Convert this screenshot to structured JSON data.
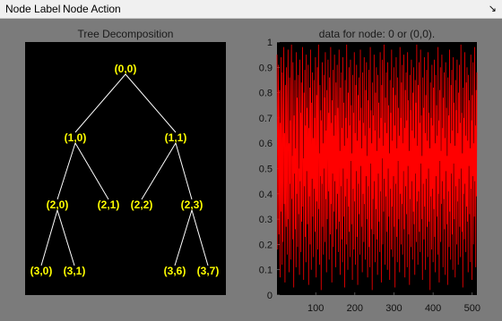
{
  "menubar": {
    "items": [
      "Node Label",
      "Node Action"
    ],
    "dock_icon": "dock-arrow-icon"
  },
  "tree_panel": {
    "title": "Tree Decomposition",
    "background": "#000000",
    "node_color": "#ffff00",
    "edge_color": "#ffffff",
    "nodes": [
      {
        "id": "n00",
        "label": "(0,0)"
      },
      {
        "id": "n10",
        "label": "(1,0)"
      },
      {
        "id": "n11",
        "label": "(1,1)"
      },
      {
        "id": "n20",
        "label": "(2,0)"
      },
      {
        "id": "n21",
        "label": "(2,1)"
      },
      {
        "id": "n22",
        "label": "(2,2)"
      },
      {
        "id": "n23",
        "label": "(2,3)"
      },
      {
        "id": "n30",
        "label": "(3,0)"
      },
      {
        "id": "n31",
        "label": "(3,1)"
      },
      {
        "id": "n36",
        "label": "(3,6)"
      },
      {
        "id": "n37",
        "label": "(3,7)"
      }
    ],
    "edges": [
      [
        "n00",
        "n10"
      ],
      [
        "n00",
        "n11"
      ],
      [
        "n10",
        "n20"
      ],
      [
        "n10",
        "n21"
      ],
      [
        "n11",
        "n22"
      ],
      [
        "n11",
        "n23"
      ],
      [
        "n20",
        "n30"
      ],
      [
        "n20",
        "n31"
      ],
      [
        "n23",
        "n36"
      ],
      [
        "n23",
        "n37"
      ]
    ]
  },
  "chart_data": {
    "type": "line",
    "title": "data for node: 0 or (0,0).",
    "xlim": [
      1,
      512
    ],
    "ylim": [
      0,
      1
    ],
    "x_ticks": [
      100,
      200,
      300,
      400,
      500
    ],
    "y_ticks": [
      0,
      0.1,
      0.2,
      0.3,
      0.4,
      0.5,
      0.6,
      0.7,
      0.8,
      0.9,
      1
    ],
    "background": "#000000",
    "line_color": "#ff0000",
    "series": [
      {
        "values": [
          0.95,
          0.62,
          0.18,
          0.77,
          0.91,
          0.24,
          0.56,
          0.81,
          0.07,
          0.68,
          0.33,
          0.94,
          0.47,
          0.12,
          0.88,
          0.59,
          0.21,
          0.73,
          0.98,
          0.36,
          0.64,
          0.05,
          0.83,
          0.41,
          0.27,
          0.9,
          0.52,
          0.16,
          0.75,
          0.97,
          0.3,
          0.6,
          0.09,
          0.86,
          0.44,
          0.69,
          0.14,
          0.79,
          0.99,
          0.38,
          0.55,
          0.22,
          0.92,
          0.65,
          0.03,
          0.71,
          0.48,
          0.85,
          0.26,
          0.58,
          0.11,
          0.96,
          0.4,
          0.78,
          0.19,
          0.63,
          0.87,
          0.32,
          0.5,
          0.08,
          0.93,
          0.45,
          0.72,
          0.17,
          0.84,
          0.29,
          0.61,
          0.98,
          0.35,
          0.54,
          0.06,
          0.8,
          0.43,
          0.89,
          0.23,
          0.67,
          0.13,
          0.95,
          0.49,
          0.74,
          0.28,
          0.57,
          0.91,
          0.04,
          0.66,
          0.39,
          0.82,
          0.2,
          0.97,
          0.53,
          0.1,
          0.76,
          0.46,
          0.88,
          0.31,
          0.62,
          0.15,
          0.85,
          0.42,
          0.7,
          0.25,
          0.94,
          0.51,
          0.07,
          0.79,
          0.37,
          0.9,
          0.18,
          0.64,
          0.99,
          0.34,
          0.56,
          0.12,
          0.83,
          0.47,
          0.73,
          0.02,
          0.69,
          0.44,
          0.92,
          0.27,
          0.6,
          0.16,
          0.87,
          0.5,
          0.78,
          0.21,
          0.96,
          0.38,
          0.65,
          0.09,
          0.81,
          0.3,
          0.58,
          0.93,
          0.41,
          0.72,
          0.14,
          0.86,
          0.55,
          0.24,
          0.98,
          0.36,
          0.68,
          0.05,
          0.77,
          0.48,
          0.89,
          0.19,
          0.63,
          0.33,
          0.95,
          0.45,
          0.71,
          0.11,
          0.84,
          0.52,
          0.26,
          0.91,
          0.4,
          0.74,
          0.17,
          0.6,
          0.97,
          0.29,
          0.57,
          0.08,
          0.82,
          0.43,
          0.88,
          0.22,
          0.66,
          0.13,
          0.94,
          0.5,
          0.76,
          0.31,
          0.59,
          0.03,
          0.85,
          0.39,
          0.7,
          0.2,
          0.99,
          0.46,
          0.62,
          0.1,
          0.8,
          0.35,
          0.9,
          0.25,
          0.67,
          0.15,
          0.93,
          0.53,
          0.75,
          0.28,
          0.56,
          0.06,
          0.87,
          0.42,
          0.72,
          0.18,
          0.96,
          0.37,
          0.64,
          0.12,
          0.83,
          0.49,
          0.91,
          0.23,
          0.61,
          0.04,
          0.79,
          0.44,
          0.86,
          0.32,
          0.69,
          0.16,
          0.97,
          0.51,
          0.74,
          0.27,
          0.58,
          0.09,
          0.88,
          0.4,
          0.68,
          0.21,
          0.94,
          0.36,
          0.63,
          0.14,
          0.81,
          0.47,
          0.92,
          0.3,
          0.55,
          0.07,
          0.77,
          0.43,
          0.89,
          0.19,
          0.66,
          0.11,
          0.98,
          0.52,
          0.73,
          0.26,
          0.6,
          0.02,
          0.84,
          0.38,
          0.71,
          0.24,
          0.95,
          0.45,
          0.65,
          0.13,
          0.8,
          0.34,
          0.9,
          0.22,
          0.57,
          0.08,
          0.87,
          0.48,
          0.76,
          0.29,
          0.62,
          0.17,
          0.96,
          0.41,
          0.7,
          0.05,
          0.83,
          0.54,
          0.93,
          0.2,
          0.59,
          0.33,
          0.99,
          0.46,
          0.68,
          0.12,
          0.78,
          0.39,
          0.88,
          0.25,
          0.64,
          0.1,
          0.92,
          0.5,
          0.75,
          0.31,
          0.56,
          0.06,
          0.85,
          0.42,
          0.72,
          0.18,
          0.97,
          0.35,
          0.61,
          0.15,
          0.82,
          0.47,
          0.9,
          0.27,
          0.67,
          0.03,
          0.79,
          0.44,
          0.94,
          0.23,
          0.58,
          0.13,
          0.86,
          0.53,
          0.74,
          0.3,
          0.63,
          0.09,
          0.98,
          0.4,
          0.7,
          0.2,
          0.84,
          0.36,
          0.91,
          0.16,
          0.6,
          0.49,
          0.95,
          0.26,
          0.66,
          0.07,
          0.81,
          0.43,
          0.88,
          0.32,
          0.69,
          0.11,
          0.96,
          0.51,
          0.77,
          0.24,
          0.57,
          0.04,
          0.87,
          0.38,
          0.73,
          0.19,
          0.93,
          0.45,
          0.65,
          0.14,
          0.8,
          0.33,
          0.9,
          0.28,
          0.62,
          0.08,
          0.85,
          0.48,
          0.76,
          0.21,
          0.99,
          0.37,
          0.59,
          0.12,
          0.83,
          0.41,
          0.92,
          0.25,
          0.68,
          0.17,
          0.97,
          0.52,
          0.71,
          0.3,
          0.55,
          0.06,
          0.86,
          0.44,
          0.74,
          0.22,
          0.94,
          0.35,
          0.64,
          0.1,
          0.79,
          0.46,
          0.89,
          0.27,
          0.61,
          0.15,
          0.96,
          0.5,
          0.72,
          0.29,
          0.58,
          0.02,
          0.84,
          0.39,
          0.7,
          0.18,
          0.91,
          0.42,
          0.67,
          0.13,
          0.82,
          0.34,
          0.93,
          0.23,
          0.6,
          0.09,
          0.87,
          0.47,
          0.75,
          0.31,
          0.63,
          0.16,
          0.98,
          0.4,
          0.69,
          0.05,
          0.81,
          0.53,
          0.9,
          0.21,
          0.57,
          0.36,
          0.95,
          0.45,
          0.66,
          0.11,
          0.78,
          0.38,
          0.88,
          0.26,
          0.62,
          0.08,
          0.92,
          0.49,
          0.74,
          0.28,
          0.55,
          0.04,
          0.86,
          0.41,
          0.71,
          0.19,
          0.97,
          0.33,
          0.6,
          0.14,
          0.83,
          0.48,
          0.89,
          0.24,
          0.65,
          0.1,
          0.94,
          0.52,
          0.76,
          0.3,
          0.59,
          0.07,
          0.85,
          0.43,
          0.73,
          0.2,
          0.93,
          0.37,
          0.64,
          0.12,
          0.8,
          0.46,
          0.91,
          0.27,
          0.68,
          0.15,
          0.99,
          0.5,
          0.72,
          0.25,
          0.56,
          0.03,
          0.82,
          0.4,
          0.7,
          0.22,
          0.96,
          0.44,
          0.63,
          0.17,
          0.84,
          0.35,
          0.9,
          0.29,
          0.61,
          0.09,
          0.87,
          0.51,
          0.77,
          0.32,
          0.58,
          0.13,
          0.95,
          0.42,
          0.69,
          0.06,
          0.79,
          0.47,
          0.92,
          0.2,
          0.6,
          0.31,
          0.98,
          0.45,
          0.67,
          0.11,
          0.81,
          0.39,
          0.88
        ]
      }
    ]
  }
}
